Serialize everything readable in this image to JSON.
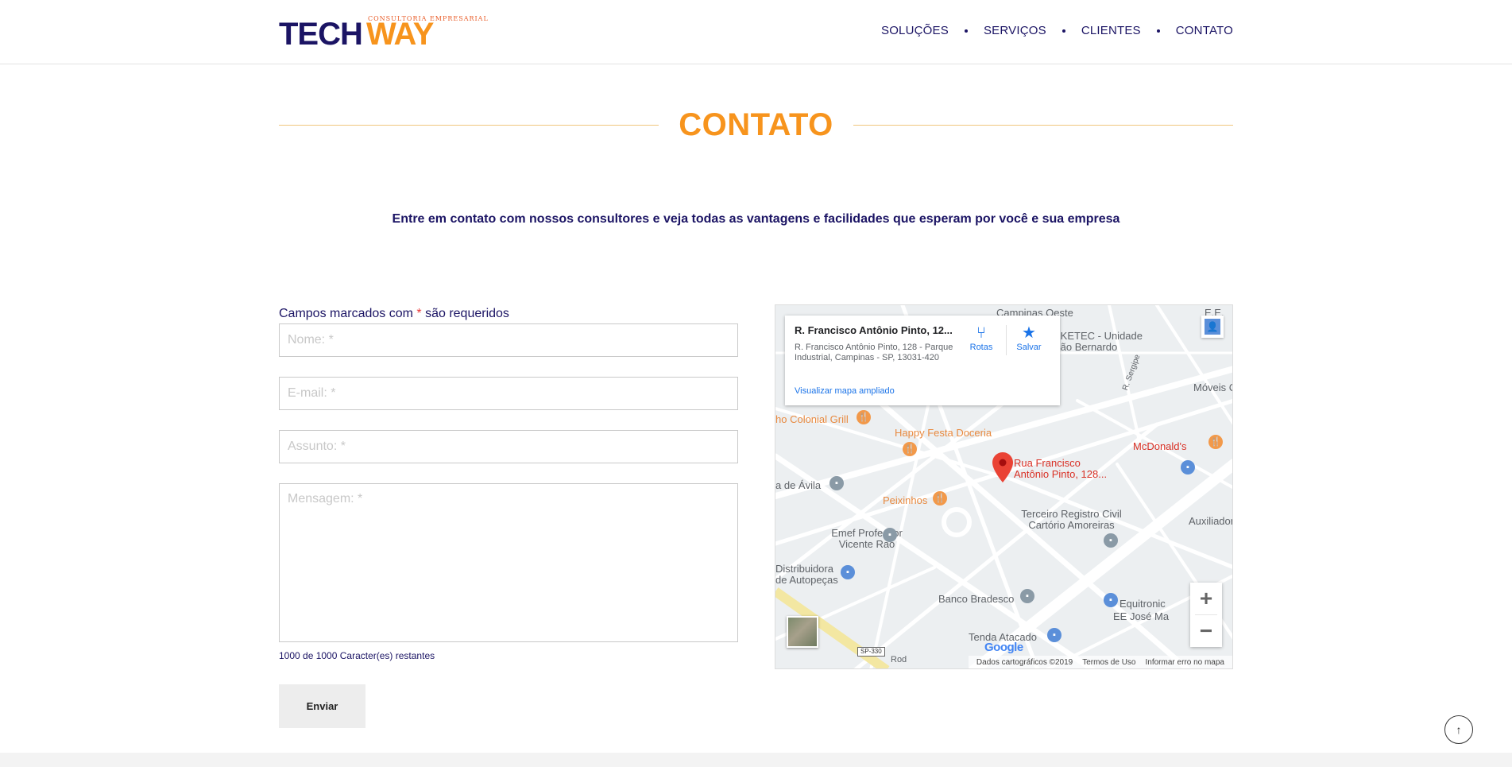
{
  "header": {
    "logo": {
      "part1": "TECH",
      "part2": "WAY",
      "tagline": "CONSULTORIA EMPRESARIAL"
    },
    "nav": [
      {
        "label": "SOLUÇÕES"
      },
      {
        "label": "SERVIÇOS"
      },
      {
        "label": "CLIENTES"
      },
      {
        "label": "CONTATO"
      }
    ]
  },
  "section": {
    "title": "CONTATO",
    "lead": "Entre em contato com nossos consultores e veja todas as vantagens e facilidades que esperam por você e sua empresa"
  },
  "form": {
    "required_note_prefix": "Campos marcados com ",
    "required_star": "*",
    "required_note_suffix": " são requeridos",
    "name_placeholder": "Nome: *",
    "email_placeholder": "E-mail: *",
    "subject_placeholder": "Assunto: *",
    "message_placeholder": "Mensagem: *",
    "char_counter": "1000 de 1000 Caracter(es) restantes",
    "submit_label": "Enviar"
  },
  "map": {
    "info": {
      "title": "R. Francisco Antônio Pinto, 12...",
      "address": "R. Francisco Antônio Pinto, 128 - Parque Industrial, Campinas - SP, 13031-420",
      "link": "Visualizar mapa ampliado",
      "directions_label": "Rotas",
      "save_label": "Salvar"
    },
    "pin_label": "Rua Francisco Antônio Pinto, 128...",
    "labels": {
      "campinas_oeste": "Campinas Oeste",
      "eketec": "EKETEC - Unidade São Bernardo",
      "ee": "E.E.",
      "moveis": "Móveis Ca",
      "colonial": "ho Colonial Grill",
      "happy": "Happy Festa Doceria",
      "mcdonalds": "McDonald's",
      "avila": "a de Ávila",
      "peixinhos": "Peixinhos",
      "terceiro": "Terceiro Registro Civil Cartório Amoreiras",
      "auxiliadora": "Auxiliadora",
      "emef": "Emef Professor Vicente Rao",
      "distribuidora": "Distribuidora de Autopeças",
      "bradesco": "Banco Bradesco",
      "equitronic": "Equitronic",
      "eejose": "EE José Ma",
      "tenda": "Tenda Atacado",
      "sp330": "SP-330",
      "rod": "Rod",
      "rsergipe": "R. Sergipe"
    },
    "footer": {
      "data": "Dados cartográficos ©2019",
      "terms": "Termos de Uso",
      "report": "Informar erro no mapa"
    },
    "google": "Google",
    "zoom_in": "+",
    "zoom_out": "−"
  },
  "colors": {
    "brand_blue": "#1b1464",
    "brand_orange": "#f7941d"
  },
  "scroll_top_icon": "↑"
}
